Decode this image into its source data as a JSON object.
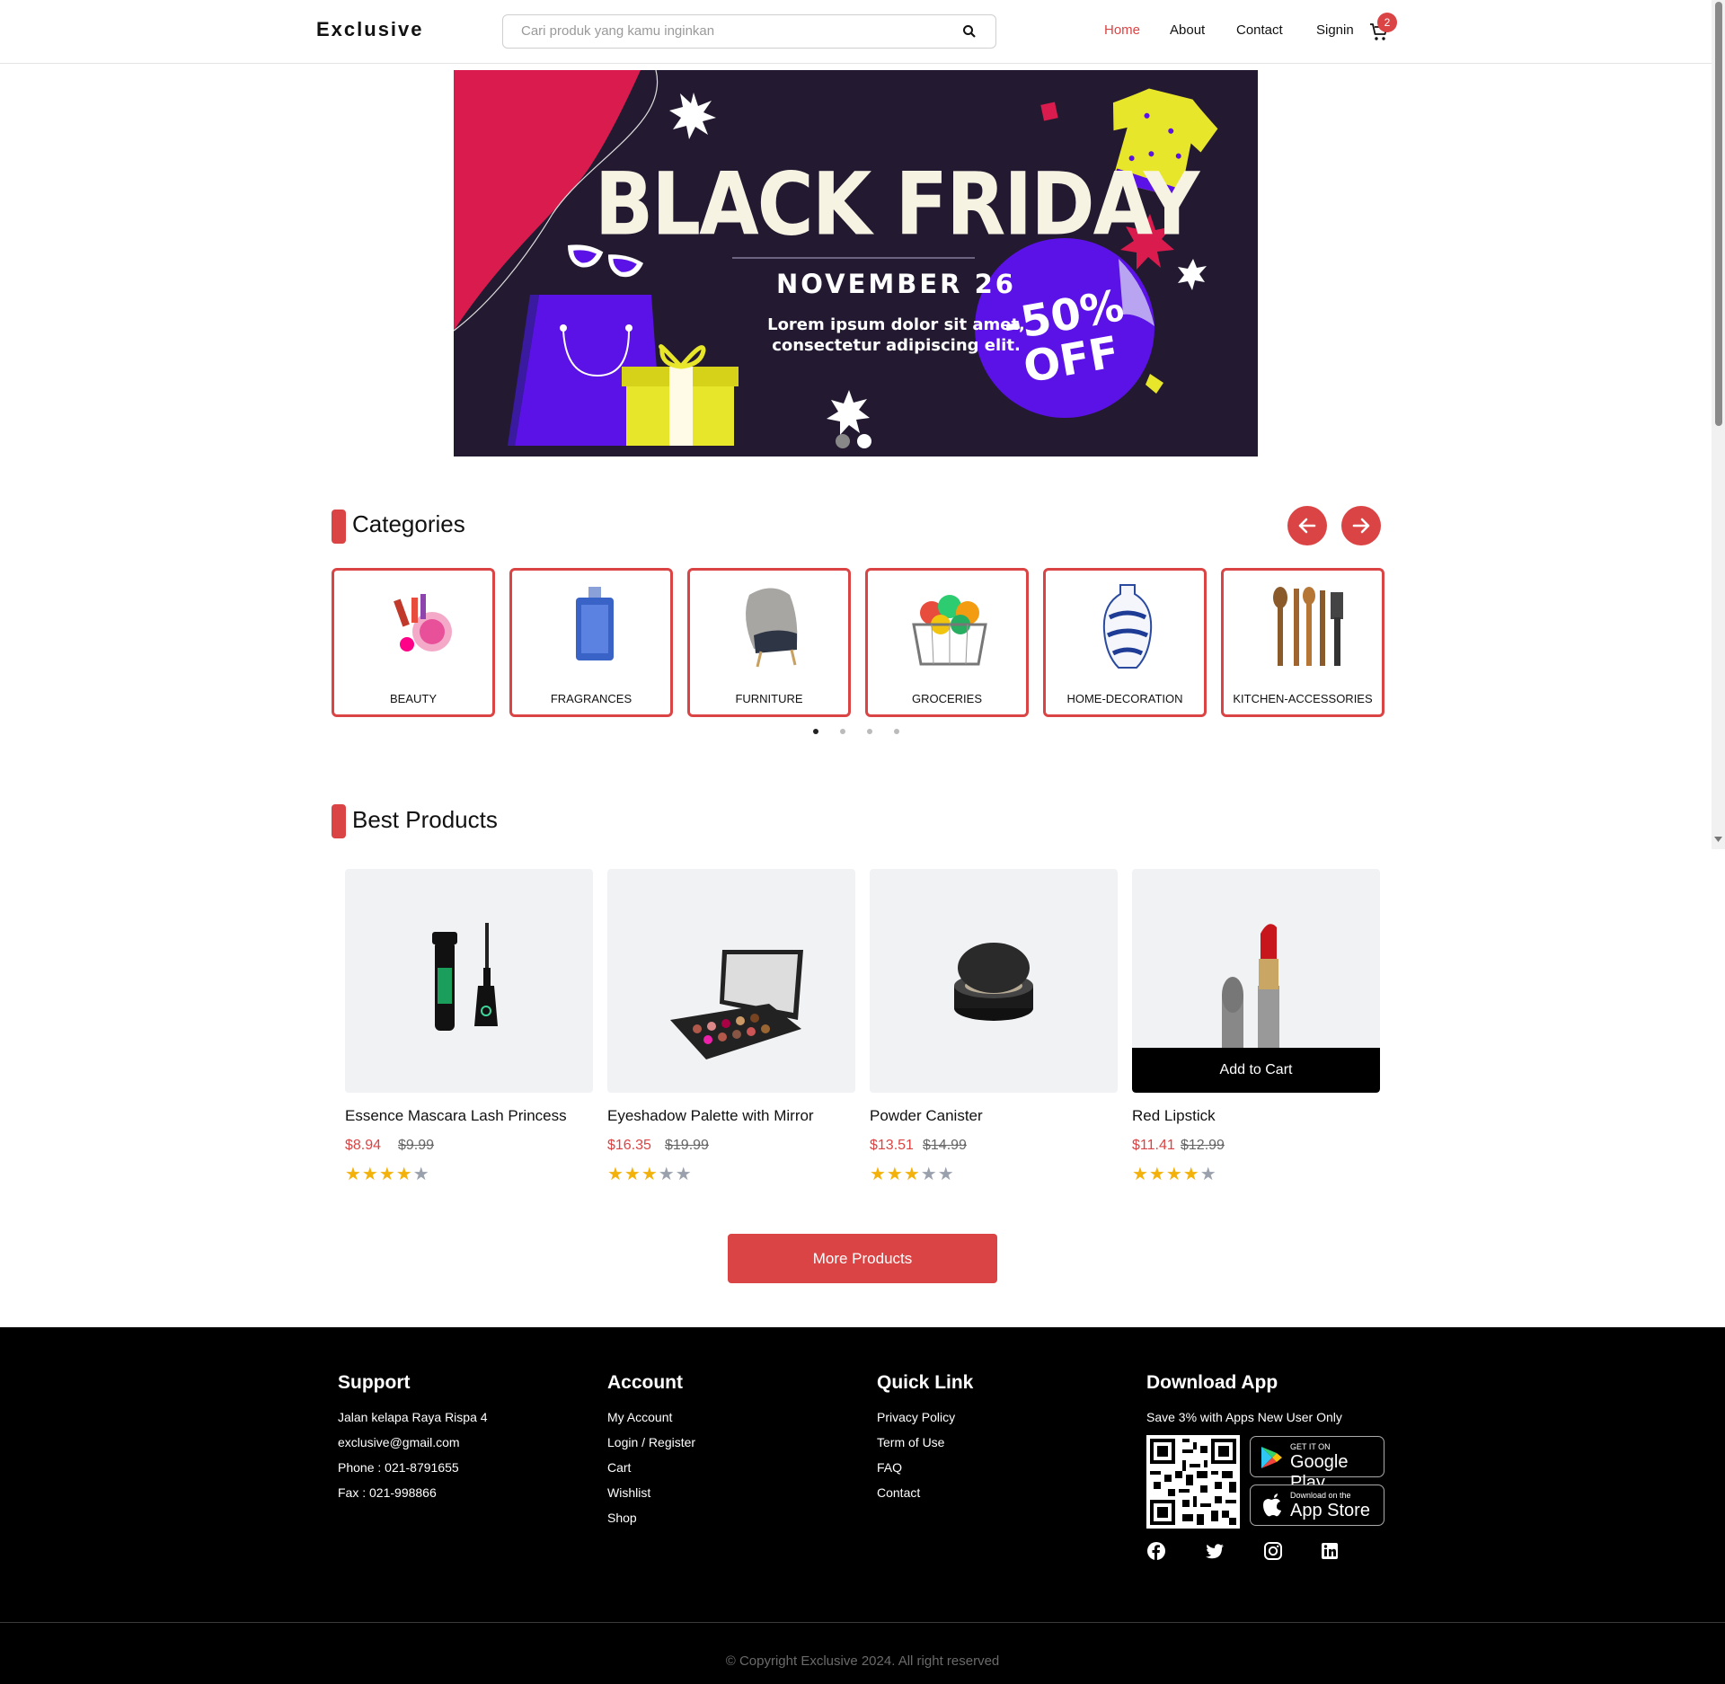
{
  "header": {
    "logo": "Exclusive",
    "search_placeholder": "Cari produk yang kamu inginkan",
    "nav": [
      "Home",
      "About",
      "Contact",
      "Signin"
    ],
    "cart_count": "2"
  },
  "banner": {
    "title": "BLACK FRIDAY",
    "date": "NOVEMBER 26",
    "text_line1": "Lorem ipsum dolor sit amet,",
    "text_line2": "consectetur adipiscing elit.",
    "discount_line1": "-50%",
    "discount_line2": "OFF"
  },
  "categories": {
    "title": "Categories",
    "items": [
      "BEAUTY",
      "FRAGRANCES",
      "FURNITURE",
      "GROCERIES",
      "HOME-DECORATION",
      "KITCHEN-ACCESSORIES"
    ]
  },
  "best_products": {
    "title": "Best Products",
    "items": [
      {
        "name": "Essence Mascara Lash Princess",
        "price": "$8.94",
        "old_price": "$9.99",
        "rating": 4
      },
      {
        "name": "Eyeshadow Palette with Mirror",
        "price": "$16.35",
        "old_price": "$19.99",
        "rating": 3
      },
      {
        "name": "Powder Canister",
        "price": "$13.51",
        "old_price": "$14.99",
        "rating": 3
      },
      {
        "name": "Red Lipstick",
        "price": "$11.41",
        "old_price": "$12.99",
        "rating": 4
      }
    ],
    "add_to_cart": "Add to Cart",
    "more_button": "More Products"
  },
  "footer": {
    "support": {
      "title": "Support",
      "items": [
        "Jalan kelapa Raya Rispa 4",
        "exclusive@gmail.com",
        "Phone : 021-8791655",
        "Fax : 021-998866"
      ]
    },
    "account": {
      "title": "Account",
      "items": [
        "My Account",
        "Login / Register",
        "Cart",
        "Wishlist",
        "Shop"
      ]
    },
    "quick_link": {
      "title": "Quick Link",
      "items": [
        "Privacy Policy",
        "Term of Use",
        "FAQ",
        "Contact"
      ]
    },
    "download": {
      "title": "Download App",
      "subtitle": "Save 3% with Apps New User Only",
      "google_small": "GET IT ON",
      "google_big": "Google Play",
      "apple_small": "Download on the",
      "apple_big": "App Store"
    },
    "copyright": "© Copyright Exclusive 2024. All right reserved"
  },
  "colors": {
    "accent": "#db4444",
    "banner_bg": "#231a31",
    "purple": "#5b12e6",
    "yellow": "#e8e62a"
  },
  "icons": [
    "search-icon",
    "cart-icon",
    "arrow-left-icon",
    "arrow-right-icon",
    "facebook-icon",
    "twitter-icon",
    "instagram-icon",
    "linkedin-icon",
    "google-play-icon",
    "apple-icon"
  ]
}
